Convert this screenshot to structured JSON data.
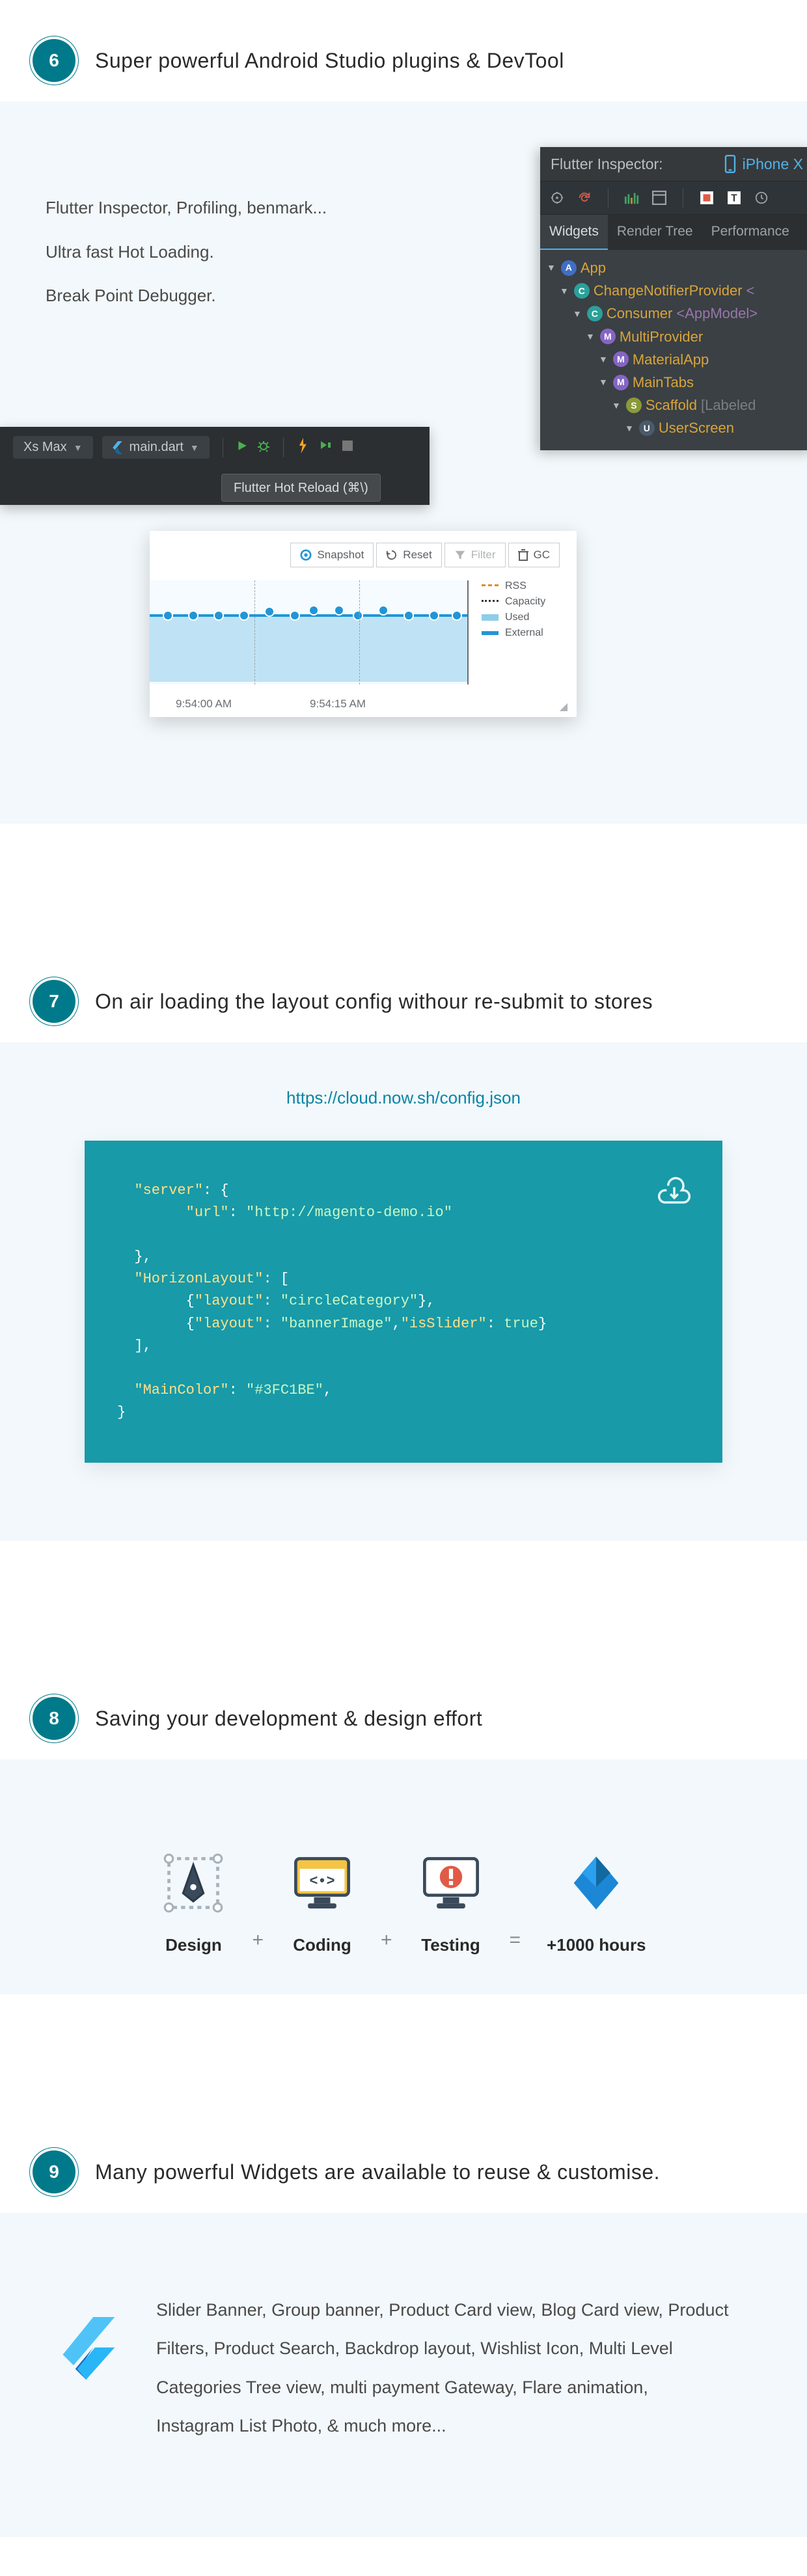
{
  "s6": {
    "num": "6",
    "title": "Super powerful Android Studio plugins & DevTool",
    "bullets": [
      "Flutter Inspector, Profiling, benmark...",
      "Ultra fast Hot Loading.",
      "Break Point Debugger."
    ],
    "inspector": {
      "title": "Flutter Inspector:",
      "device": "iPhone X",
      "tabs": [
        "Widgets",
        "Render Tree",
        "Performance"
      ],
      "tree": [
        {
          "depth": 0,
          "badge": "A",
          "cls": "nb-blue",
          "name": "App"
        },
        {
          "depth": 1,
          "badge": "C",
          "cls": "nb-teal",
          "name": "ChangeNotifierProvider",
          "angle": "<"
        },
        {
          "depth": 2,
          "badge": "C",
          "cls": "nb-teal",
          "name": "Consumer",
          "angle": "<AppModel>"
        },
        {
          "depth": 3,
          "badge": "M",
          "cls": "nb-purple",
          "name": "MultiProvider"
        },
        {
          "depth": 4,
          "badge": "M",
          "cls": "nb-purple",
          "name": "MaterialApp"
        },
        {
          "depth": 4,
          "badge": "M",
          "cls": "nb-purple",
          "name": "MainTabs"
        },
        {
          "depth": 5,
          "badge": "S",
          "cls": "nb-olive",
          "name": "Scaffold",
          "dim": "[Labeled"
        },
        {
          "depth": 6,
          "badge": "U",
          "cls": "nb-dark",
          "name": "UserScreen"
        }
      ]
    },
    "hotbar": {
      "device": "Xs Max",
      "file": "main.dart",
      "tooltip": "Flutter Hot Reload (⌘\\)"
    },
    "profiler": {
      "buttons": [
        "Snapshot",
        "Reset",
        "Filter",
        "GC"
      ],
      "legend": [
        "RSS",
        "Capacity",
        "Used",
        "External"
      ],
      "times": [
        "9:54:00 AM",
        "9:54:15 AM"
      ]
    }
  },
  "s7": {
    "num": "7",
    "title": "On air loading the layout config withour re-submit to stores",
    "link": "https://cloud.now.sh/config.json",
    "code": {
      "server_key": "\"server\"",
      "url_key": "\"url\"",
      "url_val": "\"http://magento-demo.io\"",
      "hl_key": "\"HorizonLayout\"",
      "l1_layout": "\"layout\"",
      "l1_val": "\"circleCategory\"",
      "l2_layout": "\"layout\"",
      "l2_val": "\"bannerImage\"",
      "l2_slider": "\"isSlider\"",
      "l2_bool": "true",
      "mc_key": "\"MainColor\"",
      "mc_val": "\"#3FC1BE\""
    }
  },
  "s8": {
    "num": "8",
    "title": "Saving your development & design effort",
    "cols": [
      "Design",
      "Coding",
      "Testing"
    ],
    "syms": [
      "+",
      "+",
      "="
    ],
    "result": "+1000 hours"
  },
  "s9": {
    "num": "9",
    "title": "Many powerful Widgets are available to reuse & customise.",
    "text": "Slider Banner, Group banner, Product Card view, Blog Card view, Product Filters, Product Search, Backdrop layout, Wishlist Icon, Multi Level  Categories Tree view, multi payment Gateway, Flare animation, Instagram List Photo, & much more..."
  }
}
